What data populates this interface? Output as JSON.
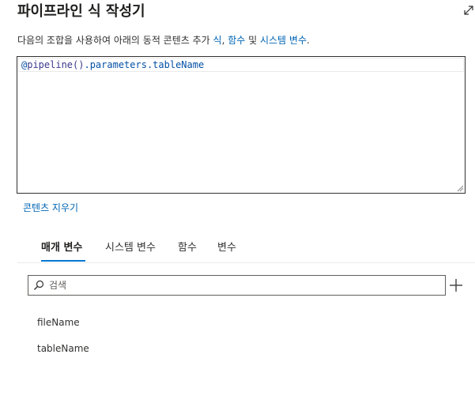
{
  "header": {
    "title": "파이프라인 식 작성기",
    "expand_icon": "expand-diagonal-icon"
  },
  "description": {
    "text": "다음의 조합을 사용하여 아래의 동적 콘텐츠 추가 ",
    "link_expression": "식",
    "sep1": ", ",
    "link_functions": "함수",
    "sep2": " 및 ",
    "link_system_variables": "시스템 변수",
    "end": "."
  },
  "editor": {
    "at": "@",
    "fn": "pipeline()",
    "rest": ".parameters.tableName"
  },
  "clear_link": "콘텐츠 지우기",
  "tabs": [
    {
      "label": "매개 변수",
      "active": true
    },
    {
      "label": "시스템 변수",
      "active": false
    },
    {
      "label": "함수",
      "active": false
    },
    {
      "label": "변수",
      "active": false
    }
  ],
  "search": {
    "placeholder": "검색",
    "value": "",
    "icon": "search-icon"
  },
  "add_button": {
    "icon": "plus-icon"
  },
  "parameters": [
    {
      "name": "fileName"
    },
    {
      "name": "tableName"
    }
  ],
  "colors": {
    "link": "#0064b4",
    "tab_underline": "#0078d4",
    "code": "#0451a5"
  }
}
